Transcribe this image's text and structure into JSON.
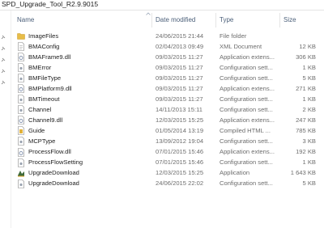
{
  "window": {
    "title": "SPD_Upgrade_Tool_R2.9.9015"
  },
  "columns": {
    "name": "Name",
    "date": "Date modified",
    "type": "Type",
    "size": "Size"
  },
  "files": [
    {
      "name": "ImageFiles",
      "date": "24/06/2015 21:44",
      "type": "File folder",
      "size": "",
      "icon": "folder-icon"
    },
    {
      "name": "BMAConfig",
      "date": "02/04/2013 09:49",
      "type": "XML Document",
      "size": "12 KB",
      "icon": "file-icon"
    },
    {
      "name": "BMAFrame9.dll",
      "date": "09/03/2015 11:27",
      "type": "Application extens...",
      "size": "306 KB",
      "icon": "dll-file-icon"
    },
    {
      "name": "BMError",
      "date": "09/03/2015 11:27",
      "type": "Configuration sett...",
      "size": "1 KB",
      "icon": "config-file-icon"
    },
    {
      "name": "BMFileType",
      "date": "09/03/2015 11:27",
      "type": "Configuration sett...",
      "size": "5 KB",
      "icon": "config-file-icon"
    },
    {
      "name": "BMPlatform9.dll",
      "date": "09/03/2015 11:27",
      "type": "Application extens...",
      "size": "271 KB",
      "icon": "dll-file-icon"
    },
    {
      "name": "BMTimeout",
      "date": "09/03/2015 11:27",
      "type": "Configuration sett...",
      "size": "1 KB",
      "icon": "config-file-icon"
    },
    {
      "name": "Channel",
      "date": "14/11/2013 15:11",
      "type": "Configuration sett...",
      "size": "2 KB",
      "icon": "config-file-icon"
    },
    {
      "name": "Channel9.dll",
      "date": "12/03/2015 15:25",
      "type": "Application extens...",
      "size": "247 KB",
      "icon": "dll-file-icon"
    },
    {
      "name": "Guide",
      "date": "01/05/2014 13:19",
      "type": "Compiled HTML ...",
      "size": "785 KB",
      "icon": "help-file-icon"
    },
    {
      "name": "MCPType",
      "date": "13/09/2012 19:04",
      "type": "Configuration sett...",
      "size": "3 KB",
      "icon": "config-file-icon"
    },
    {
      "name": "ProcessFlow.dll",
      "date": "07/01/2015 15:46",
      "type": "Application extens...",
      "size": "192 KB",
      "icon": "dll-file-icon"
    },
    {
      "name": "ProcessFlowSetting",
      "date": "07/01/2015 15:46",
      "type": "Configuration sett...",
      "size": "1 KB",
      "icon": "config-file-icon"
    },
    {
      "name": "UpgradeDownload",
      "date": "12/03/2015 15:25",
      "type": "Application",
      "size": "1 643 KB",
      "icon": "application-icon"
    },
    {
      "name": "UpgradeDownload",
      "date": "24/06/2015 22:02",
      "type": "Configuration sett...",
      "size": "5 KB",
      "icon": "config-file-icon"
    }
  ],
  "colors": {
    "folder": "#e8bd48",
    "header_text": "#4c607a",
    "meta_text": "#6d6d6d"
  }
}
